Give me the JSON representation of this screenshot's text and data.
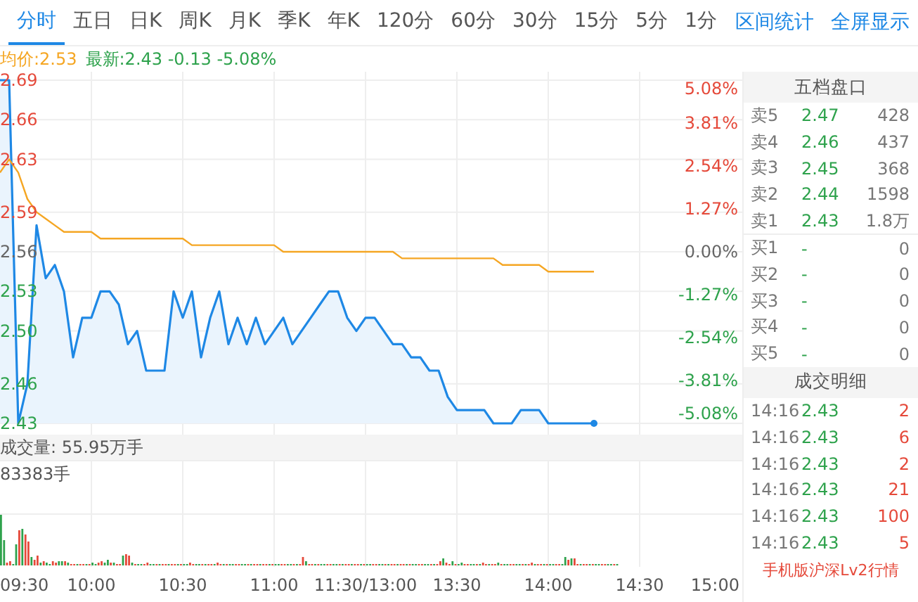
{
  "tabs": [
    {
      "label": "分时",
      "selected": true
    },
    {
      "label": "五日",
      "selected": false
    },
    {
      "label": "日K",
      "selected": false
    },
    {
      "label": "周K",
      "selected": false
    },
    {
      "label": "月K",
      "selected": false
    },
    {
      "label": "季K",
      "selected": false
    },
    {
      "label": "年K",
      "selected": false
    },
    {
      "label": "120分",
      "selected": false
    },
    {
      "label": "60分",
      "selected": false
    },
    {
      "label": "30分",
      "selected": false
    },
    {
      "label": "15分",
      "selected": false
    },
    {
      "label": "5分",
      "selected": false
    },
    {
      "label": "1分",
      "selected": false
    }
  ],
  "tools": [
    "区间统计",
    "全屏显示"
  ],
  "quote": {
    "average": "均价:2.53",
    "latest": "最新:2.43 -0.13 -5.08%"
  },
  "price_chart": {
    "chart_data": {
      "type": "line",
      "grid": true,
      "ylim": [
        2.43,
        2.69
      ],
      "categories": [
        null,
        null,
        null,
        null,
        null,
        null,
        null,
        null,
        null,
        null,
        null,
        null,
        null,
        null,
        null,
        null,
        null,
        null,
        null,
        null,
        null,
        null,
        null,
        null,
        null,
        null,
        null,
        null,
        null,
        null,
        null,
        null,
        null,
        null,
        null,
        null,
        null,
        null,
        null,
        null,
        null,
        null,
        null,
        null,
        null,
        null,
        null,
        null,
        null,
        null,
        null,
        null,
        null,
        null,
        null,
        null,
        null,
        null,
        null,
        null,
        null,
        null,
        null,
        null,
        null,
        null
      ],
      "series": [
        {
          "color": "#1e88e5",
          "values": [
            2.69,
            2.69,
            2.43,
            2.46,
            2.58,
            2.54,
            2.55,
            2.53,
            2.48,
            2.51,
            2.51,
            2.53,
            2.53,
            2.52,
            2.49,
            2.5,
            2.47,
            2.47,
            2.47,
            2.53,
            2.51,
            2.53,
            2.48,
            2.51,
            2.53,
            2.49,
            2.51,
            2.49,
            2.51,
            2.49,
            2.5,
            2.51,
            2.49,
            2.5,
            2.51,
            2.52,
            2.53,
            2.53,
            2.51,
            2.5,
            2.51,
            2.51,
            2.5,
            2.49,
            2.49,
            2.48,
            2.48,
            2.47,
            2.47,
            2.45,
            2.44,
            2.44,
            2.44,
            2.44,
            2.43,
            2.43,
            2.43,
            2.44,
            2.44,
            2.44,
            2.43,
            2.43,
            2.43,
            2.43,
            2.43,
            2.43
          ]
        },
        {
          "color": "#f5a623",
          "values": [
            2.62,
            2.63,
            2.62,
            2.6,
            2.59,
            2.585,
            2.58,
            2.575,
            2.575,
            2.575,
            2.575,
            2.57,
            2.57,
            2.57,
            2.57,
            2.57,
            2.57,
            2.57,
            2.57,
            2.57,
            2.57,
            2.565,
            2.565,
            2.565,
            2.565,
            2.565,
            2.565,
            2.565,
            2.565,
            2.565,
            2.565,
            2.56,
            2.56,
            2.56,
            2.56,
            2.56,
            2.56,
            2.56,
            2.56,
            2.56,
            2.56,
            2.56,
            2.56,
            2.56,
            2.555,
            2.555,
            2.555,
            2.555,
            2.555,
            2.555,
            2.555,
            2.555,
            2.555,
            2.555,
            2.555,
            2.55,
            2.55,
            2.55,
            2.55,
            2.55,
            2.545,
            2.545,
            2.545,
            2.545,
            2.545,
            2.545
          ]
        }
      ],
      "yticks": [
        {
          "value": 2.69,
          "label": "2.69"
        },
        {
          "value": 2.66,
          "label": "2.66"
        },
        {
          "value": 2.63,
          "label": "2.63"
        },
        {
          "value": 2.59,
          "label": "2.59"
        },
        {
          "value": 2.56,
          "label": "2.56"
        },
        {
          "value": 2.53,
          "label": "2.53"
        },
        {
          "value": 2.5,
          "label": "2.50"
        },
        {
          "value": 2.46,
          "label": "2.46"
        },
        {
          "value": 2.43,
          "label": "2.43"
        }
      ]
    },
    "time_labels": [
      "09:30",
      "10:00",
      "10:30",
      "11:00",
      "11:30/13:00",
      "13:30",
      "14:00",
      "14:30",
      "15:00"
    ],
    "percent_labels": [
      "5.08%",
      "3.81%",
      "2.54%",
      "1.27%",
      "0.00%",
      "-1.27%",
      "-2.54%",
      "-3.81%",
      "-5.08%"
    ]
  },
  "volume": {
    "title": "成交量: 55.95万手",
    "max_label": "83383手"
  },
  "order_book": {
    "title": "五档盘口",
    "sells": [
      {
        "label": "卖5",
        "price": "2.47",
        "volume": "428"
      },
      {
        "label": "卖4",
        "price": "2.46",
        "volume": "437"
      },
      {
        "label": "卖3",
        "price": "2.45",
        "volume": "368"
      },
      {
        "label": "卖2",
        "price": "2.44",
        "volume": "1598"
      },
      {
        "label": "卖1",
        "price": "2.43",
        "volume": "1.8万"
      }
    ],
    "buys": [
      {
        "label": "买1",
        "price": "-",
        "volume": "0"
      },
      {
        "label": "买2",
        "price": "-",
        "volume": "0"
      },
      {
        "label": "买3",
        "price": "-",
        "volume": "0"
      },
      {
        "label": "买4",
        "price": "-",
        "volume": "0"
      },
      {
        "label": "买5",
        "price": "-",
        "volume": "0"
      }
    ]
  },
  "trades": {
    "title": "成交明细",
    "rows": [
      {
        "time": "14:16",
        "price": "2.43",
        "volume": "2"
      },
      {
        "time": "14:16",
        "price": "2.43",
        "volume": "6"
      },
      {
        "time": "14:16",
        "price": "2.43",
        "volume": "2"
      },
      {
        "time": "14:16",
        "price": "2.43",
        "volume": "21"
      },
      {
        "time": "14:16",
        "price": "2.43",
        "volume": "100"
      },
      {
        "time": "14:16",
        "price": "2.43",
        "volume": "5"
      }
    ],
    "link": "手机版沪深Lv2行情"
  }
}
